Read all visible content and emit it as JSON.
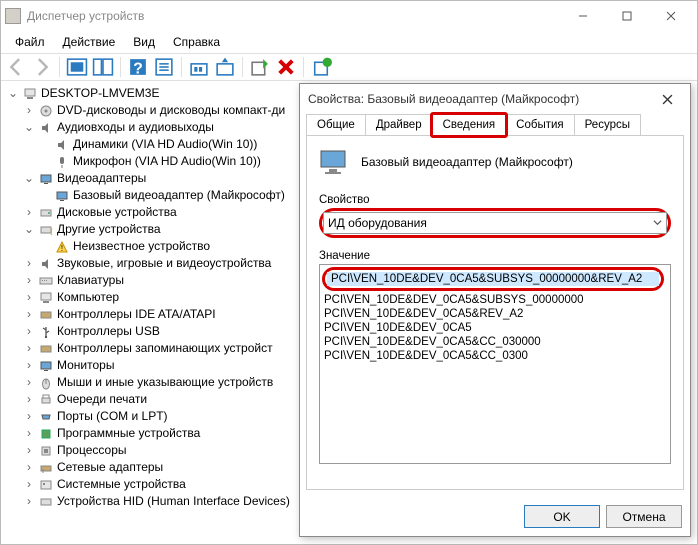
{
  "window": {
    "title": "Диспетчер устройств"
  },
  "menu": {
    "file": "Файл",
    "action": "Действие",
    "view": "Вид",
    "help": "Справка"
  },
  "tree": {
    "root": "DESKTOP-LMVEM3E",
    "dvd": "DVD-дисководы и дисководы компакт-ди",
    "audio": "Аудиовходы и аудиовыходы",
    "audio_speakers": "Динамики (VIA HD Audio(Win 10))",
    "audio_mic": "Микрофон (VIA HD Audio(Win 10))",
    "video": "Видеоадаптеры",
    "video_basic": "Базовый видеоадаптер (Майкрософт)",
    "disks": "Дисковые устройства",
    "other": "Другие устройства",
    "other_unknown": "Неизвестное устройство",
    "sound": "Звуковые, игровые и видеоустройства",
    "keyboards": "Клавиатуры",
    "computer": "Компьютер",
    "ide": "Контроллеры IDE ATA/ATAPI",
    "usb": "Контроллеры USB",
    "storage": "Контроллеры запоминающих устройст",
    "monitors": "Мониторы",
    "mice": "Мыши и иные указывающие устройств",
    "print": "Очереди печати",
    "ports": "Порты (COM и LPT)",
    "software": "Программные устройства",
    "cpu": "Процессоры",
    "network": "Сетевые адаптеры",
    "system": "Системные устройства",
    "hid": "Устройства HID (Human Interface Devices)"
  },
  "dlg": {
    "title": "Свойства: Базовый видеоадаптер (Майкрософт)",
    "tabs": {
      "general": "Общие",
      "driver": "Драйвер",
      "details": "Сведения",
      "events": "События",
      "resources": "Ресурсы"
    },
    "device_name": "Базовый видеоадаптер (Майкрософт)",
    "property_label": "Свойство",
    "property_value": "ИД оборудования",
    "value_label": "Значение",
    "values": {
      "v0": "PCI\\VEN_10DE&DEV_0CA5&SUBSYS_00000000&REV_A2",
      "v1": "PCI\\VEN_10DE&DEV_0CA5&SUBSYS_00000000",
      "v2": "PCI\\VEN_10DE&DEV_0CA5&REV_A2",
      "v3": "PCI\\VEN_10DE&DEV_0CA5",
      "v4": "PCI\\VEN_10DE&DEV_0CA5&CC_030000",
      "v5": "PCI\\VEN_10DE&DEV_0CA5&CC_0300"
    },
    "ok": "OK",
    "cancel": "Отмена"
  }
}
